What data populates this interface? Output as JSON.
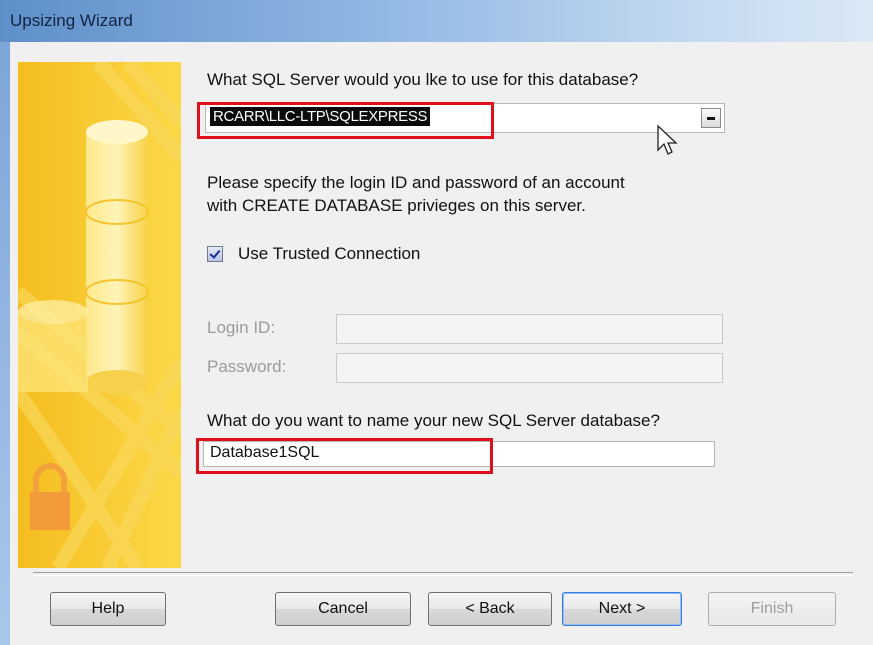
{
  "window": {
    "title": "Upsizing Wizard"
  },
  "server": {
    "question": "What SQL Server would you lke to use for this database?",
    "selected": "RCARR\\LLC-LTP\\SQLEXPRESS"
  },
  "login": {
    "instructions_line1": "Please specify the login ID and password of an account",
    "instructions_line2": "with CREATE DATABASE privieges on this server.",
    "trusted_label": "Use Trusted Connection",
    "trusted_checked": true,
    "login_id_label": "Login ID:",
    "password_label": "Password:",
    "login_id_value": "",
    "password_value": ""
  },
  "database": {
    "question": "What do you want to name your new SQL Server database?",
    "name": "Database1SQL"
  },
  "buttons": {
    "help": "Help",
    "cancel": "Cancel",
    "back": "< Back",
    "next": "Next >",
    "finish": "Finish"
  },
  "colors": {
    "highlight": "#e0101a",
    "art_primary": "#f7c62b",
    "art_secondary": "#fbe46d",
    "titlebar": "#7ea5d8"
  },
  "icons": [
    "database-cylinder-icon",
    "padlock-icon",
    "dropdown-arrow-icon",
    "checkmark-icon",
    "mouse-pointer-icon"
  ]
}
